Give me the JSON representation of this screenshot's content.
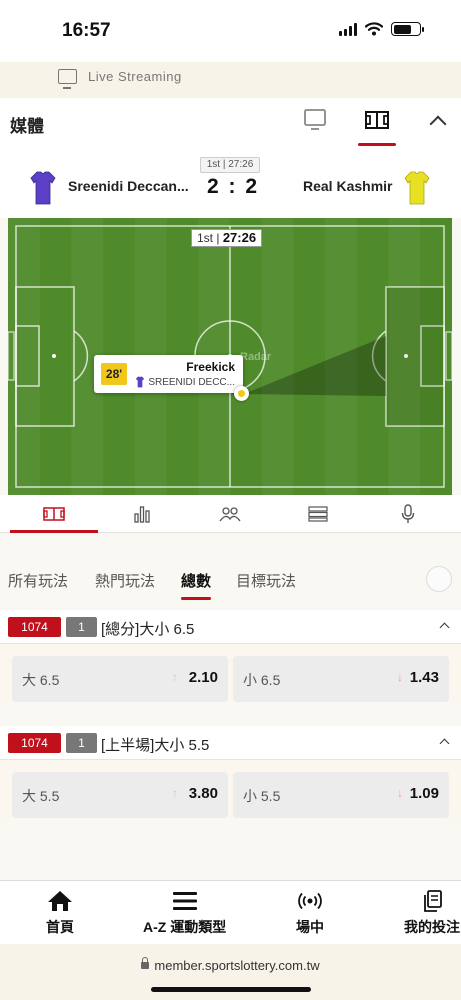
{
  "status_bar": {
    "time": "16:57"
  },
  "live_streaming": {
    "label": "Live Streaming"
  },
  "media": {
    "title": "媒體"
  },
  "match": {
    "period_label": "1st | 27:26",
    "home_team": "Sreenidi Deccan...",
    "away_team": "Real Kashmir",
    "home_score": "2",
    "separator": ":",
    "away_score": "2",
    "home_color": "#5b3fc4",
    "away_color": "#e8e022"
  },
  "tracker": {
    "period": "1st",
    "clock": "27:26",
    "watermark": "Radar",
    "event": {
      "minute": "28'",
      "type": "Freekick",
      "team": "SREENIDI DECC..."
    }
  },
  "stat_tabs": [
    "pitch-icon",
    "bar-chart-icon",
    "lineup-icon",
    "list-icon",
    "microphone-icon"
  ],
  "market_tabs": [
    {
      "label": "所有玩法",
      "active": false
    },
    {
      "label": "熱門玩法",
      "active": false
    },
    {
      "label": "總數",
      "active": true
    },
    {
      "label": "目標玩法",
      "active": false
    }
  ],
  "markets": [
    {
      "id": "1074",
      "count": "1",
      "title": "[總分]大小 6.5",
      "over": {
        "label": "大 6.5",
        "value": "2.10",
        "trend": "up"
      },
      "under": {
        "label": "小 6.5",
        "value": "1.43",
        "trend": "down"
      }
    },
    {
      "id": "1074",
      "count": "1",
      "title": "[上半場]大小 5.5",
      "over": {
        "label": "大 5.5",
        "value": "3.80",
        "trend": "up"
      },
      "under": {
        "label": "小 5.5",
        "value": "1.09",
        "trend": "down"
      }
    }
  ],
  "bottom_nav": [
    {
      "label": "首頁",
      "icon": "home-icon"
    },
    {
      "label": "A-Z 運動類型",
      "icon": "menu-icon"
    },
    {
      "label": "場中",
      "icon": "live-broadcast-icon"
    },
    {
      "label": "我的投注",
      "icon": "bets-copy-icon"
    }
  ],
  "url": "member.sportslottery.com.tw",
  "colors": {
    "accent": "#c0101c",
    "pitch": "#4f8b2a"
  }
}
